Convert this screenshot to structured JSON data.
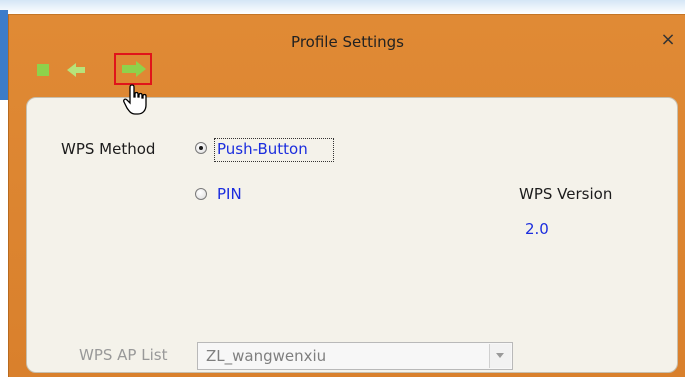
{
  "window": {
    "title": "Profile Settings",
    "close_glyph": "×"
  },
  "toolbar": {
    "stop_icon": "stop-square-icon",
    "back_icon": "arrow-left-icon",
    "next_icon": "arrow-right-icon",
    "next_highlight_color": "#e0141a",
    "icon_color": "#8fd24b"
  },
  "wps": {
    "method_label": "WPS Method",
    "options": [
      {
        "label": "Push-Button",
        "selected": true
      },
      {
        "label": "PIN",
        "selected": false
      }
    ],
    "version_label": "WPS Version",
    "version_value": "2.0",
    "ap_list_label": "WPS AP List",
    "ap_list_value": "ZL_wangwenxiu"
  },
  "colors": {
    "title_bar": "#e08a35",
    "content_bg": "#f4f2ea",
    "link_blue": "#1b2dde"
  }
}
